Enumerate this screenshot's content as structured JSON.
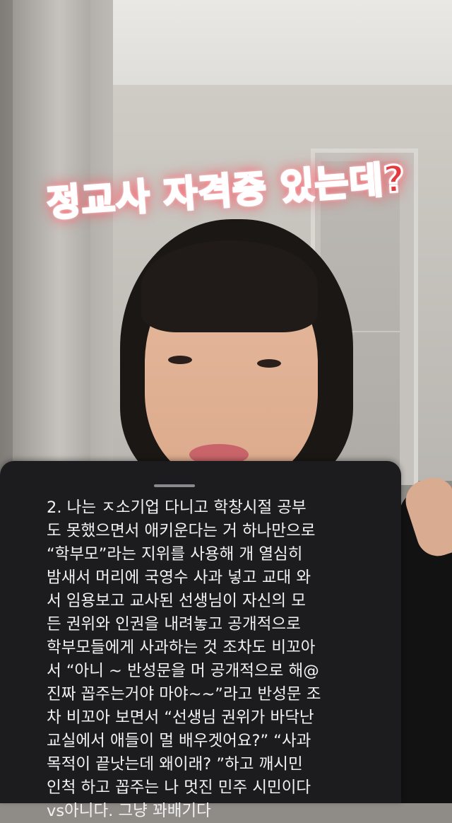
{
  "overlay": {
    "sticker_text": "정교사 자격증 있는데?"
  },
  "panel": {
    "lines": [
      "2. 나는 ㅈ소기업 다니고 학창시절 공부",
      "도 못했으면서 애키운다는 거 하나만으로",
      "“학부모”라는 지위를 사용해 개 열심히",
      "밤새서 머리에 국영수 사과 넣고 교대 와",
      "서 임용보고 교사된 선생님이 자신의 모",
      "든 권위와 인권을 내려놓고 공개적으로",
      "학부모들에게 사과하는 것 조차도 비꼬아",
      "서 “아니 ~ 반성문을 머 공개적으로 해@",
      "진짜 꼽주는거야 마야~~”라고 반성문 조",
      "차 비꼬아 보면서 “선생님 권위가 바닥난",
      "교실에서 애들이 멀 배우겟어요?” “사과",
      "목적이 끝낫는데 왜이래? ”하고 깨시민",
      "인척 하고 꼽주는 나 멋진 민주 시민이다",
      "vs아니다. 그냥 꽈배기다"
    ]
  }
}
